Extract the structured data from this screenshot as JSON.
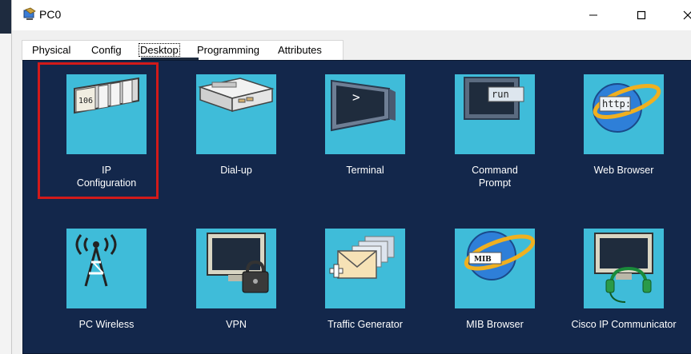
{
  "window": {
    "title": "PC0",
    "controls": {
      "minimize_icon": "minimize-icon",
      "maximize_icon": "maximize-icon",
      "close_icon": "close-icon"
    }
  },
  "tabs": [
    {
      "label": "Physical",
      "active": false
    },
    {
      "label": "Config",
      "active": false
    },
    {
      "label": "Desktop",
      "active": true
    },
    {
      "label": "Programming",
      "active": false
    },
    {
      "label": "Attributes",
      "active": false
    }
  ],
  "desktop": {
    "background": "#13274b",
    "tile_color": "#3fbcd9",
    "highlight_color": "#d21a1a",
    "highlighted_app": "IP Configuration",
    "apps": [
      {
        "label_lines": [
          "IP",
          "Configuration"
        ],
        "icon": "ip-config-icon",
        "icon_text": "106"
      },
      {
        "label_lines": [
          "Dial-up"
        ],
        "icon": "modem-icon"
      },
      {
        "label_lines": [
          "Terminal"
        ],
        "icon": "terminal-icon",
        "icon_text": ">"
      },
      {
        "label_lines": [
          "Command",
          "Prompt"
        ],
        "icon": "command-prompt-icon",
        "icon_text": "run"
      },
      {
        "label_lines": [
          "Web Browser"
        ],
        "icon": "web-browser-icon",
        "icon_text": "http:"
      },
      {
        "label_lines": [
          "PC Wireless"
        ],
        "icon": "wireless-tower-icon"
      },
      {
        "label_lines": [
          "VPN"
        ],
        "icon": "vpn-lock-icon"
      },
      {
        "label_lines": [
          "Traffic Generator"
        ],
        "icon": "traffic-generator-icon"
      },
      {
        "label_lines": [
          "MIB Browser"
        ],
        "icon": "mib-browser-icon",
        "icon_text": "MIB"
      },
      {
        "label_lines": [
          "Cisco IP Communicator"
        ],
        "icon": "ip-communicator-icon"
      }
    ]
  }
}
